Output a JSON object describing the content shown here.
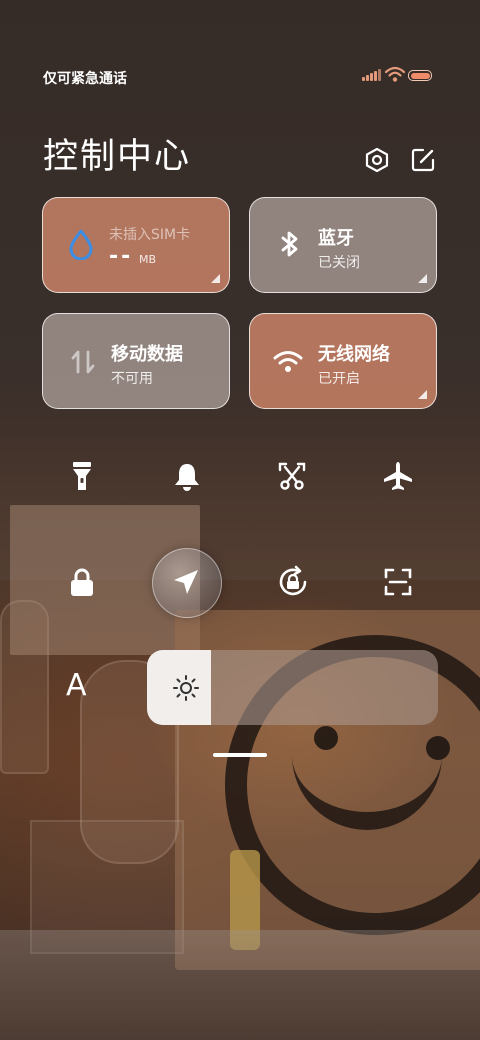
{
  "status_bar": {
    "carrier_text": "仅可紧急通话",
    "signal_icon": "signal-icon",
    "wifi_icon": "wifi-icon",
    "battery_icon": "battery-icon"
  },
  "header": {
    "title": "控制中心",
    "settings_icon": "settings-hexagon-icon",
    "edit_icon": "edit-icon"
  },
  "tiles": {
    "sim": {
      "line1": "未插入SIM卡",
      "value": "--",
      "unit": "MB",
      "icon": "water-drop-icon"
    },
    "bluetooth": {
      "label": "蓝牙",
      "status": "已关闭",
      "icon": "bluetooth-icon"
    },
    "mobile_data": {
      "label": "移动数据",
      "status": "不可用",
      "icon": "data-arrows-icon"
    },
    "wifi": {
      "label": "无线网络",
      "status": "已开启",
      "icon": "wifi-icon"
    }
  },
  "toggles": [
    {
      "icon": "flashlight-icon"
    },
    {
      "icon": "bell-icon"
    },
    {
      "icon": "screenshot-scissors-icon"
    },
    {
      "icon": "airplane-icon"
    },
    {
      "icon": "lock-icon"
    },
    {
      "icon": "location-icon",
      "active": true
    },
    {
      "icon": "rotation-lock-icon"
    },
    {
      "icon": "scan-icon"
    }
  ],
  "brightness": {
    "font_label": "A",
    "level": 0.22,
    "icon": "sun-icon"
  },
  "colors": {
    "tile_active": "#c48064",
    "tile_inactive": "#aa9c96",
    "accent_blue": "#3a8ee6",
    "battery": "#f08c6a"
  }
}
